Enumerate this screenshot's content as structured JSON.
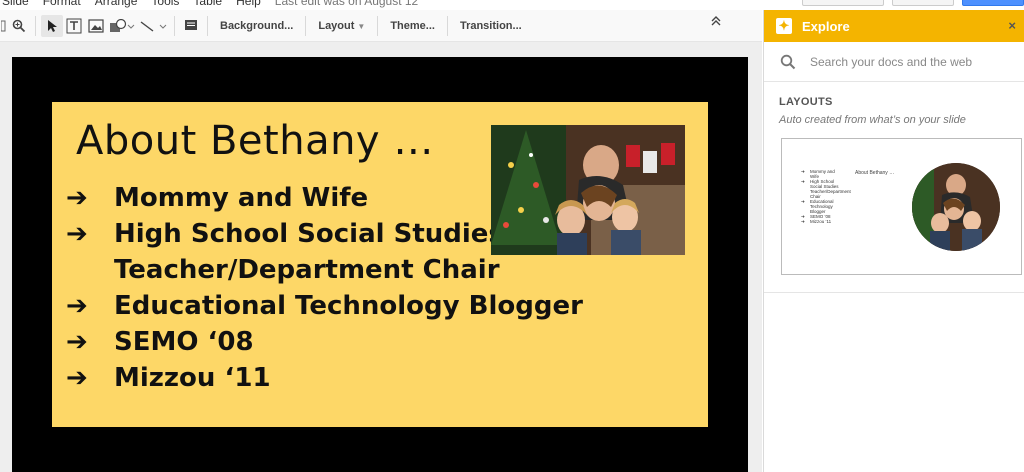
{
  "menu": {
    "items": [
      "Slide",
      "Format",
      "Arrange",
      "Tools",
      "Table",
      "Help"
    ],
    "last_edit": "Last edit was on August 12"
  },
  "toolbar": {
    "background_label": "Background...",
    "layout_label": "Layout",
    "theme_label": "Theme...",
    "transition_label": "Transition..."
  },
  "slide": {
    "title": "About Bethany …",
    "arrow": "➔",
    "bullets": [
      "Mommy and Wife",
      "High School Social Studies",
      "Teacher/Department Chair",
      "Educational Technology Blogger",
      "SEMO ‘08",
      "Mizzou ‘11"
    ],
    "bullet_markers": [
      true,
      true,
      false,
      true,
      true,
      true
    ],
    "colors": {
      "background": "#000000",
      "card": "#fdd767",
      "text": "#111111"
    }
  },
  "explore": {
    "title": "Explore",
    "close": "×",
    "search_placeholder": "Search your docs and the web",
    "layouts_heading": "LAYOUTS",
    "layouts_subtitle": "Auto created from what’s on your slide",
    "accent": "#f4b400",
    "thumbnail": {
      "title": "About Bethany …",
      "bullets": [
        "Mommy and Wife",
        "High School Social Studies Teacher/Department Chair",
        "Educational Technology Blogger",
        "SEMO ‘08",
        "Mizzou ‘11"
      ]
    }
  }
}
